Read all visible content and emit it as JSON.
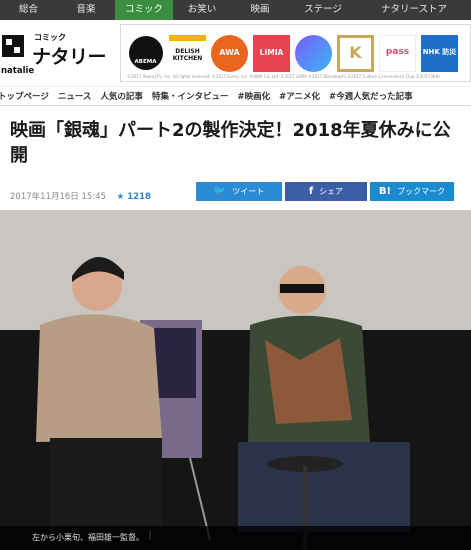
{
  "top_nav": {
    "items": [
      "総合",
      "音楽",
      "コミック",
      "お笑い",
      "映画",
      "ステージ",
      "ナタリーストア"
    ],
    "active_index": 2,
    "active_color": "#3b8d3f"
  },
  "logo": {
    "sub": "コミック",
    "name": "ナタリー",
    "roman": "natalie"
  },
  "banner": {
    "tiles": [
      "ABEMA",
      "DELISH KITCHEN",
      "AWA",
      "LIMIA",
      "",
      "K",
      "pass",
      "NHK 防災"
    ],
    "fine_print": "©2017 AbemaTV, Inc. All rights reserved.  ©2017 Every, Inc.  ©AWA Co. Ltd.  ©2017 LIMIA  ©2017 Nihonbashi  ©2017 Culture Convenience Club  ©2017 NHK"
  },
  "sec_nav": {
    "items": [
      "トップページ",
      "ニュース",
      "人気の記事",
      "特集・インタビュー",
      "#映画化",
      "#アニメ化",
      "#今週人気だった記事"
    ]
  },
  "article": {
    "title": "映画「銀魂」パート2の製作決定！2018年夏休みに公開",
    "date": "2017年11月16日 15:45",
    "star_count": "1218",
    "share": {
      "tweet": "ツイート",
      "facebook": "シェア",
      "bookmark": "ブックマーク"
    },
    "caption": "左から小栗旬、福田雄一監督。"
  }
}
